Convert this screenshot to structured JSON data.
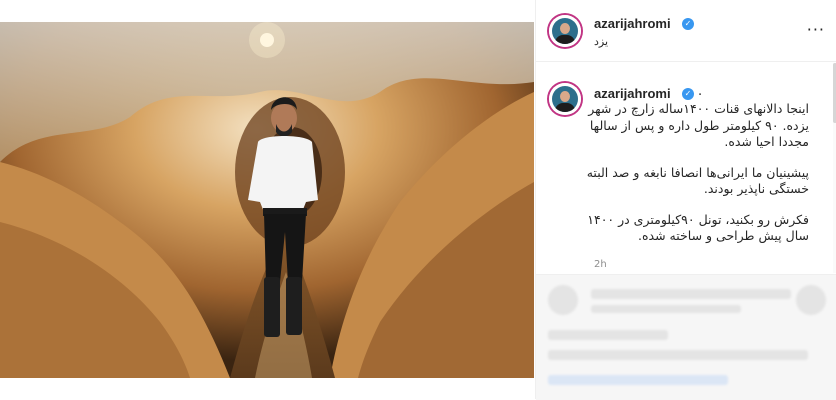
{
  "post": {
    "username": "azarijahromi",
    "location": "یزد",
    "more_label": "···",
    "caption": {
      "username": "azarijahromi",
      "dot": ".",
      "paragraphs": [
        "اینجا دالانهای قنات ۱۴۰۰ساله زارچ در شهر یزده. ۹۰ کیلومتر طول داره و پس از سالها مجددا احیا شده.",
        "پیشینیان ما ایرانی‌ها انصافا نابغه و صد البته خستگی ناپذیر بودند.",
        "فکرش رو بکنید، تونل ۹۰کیلومتری در ۱۴۰۰ سال پیش طراحی و ساخته شده."
      ],
      "time": "2h"
    }
  },
  "colors": {
    "verified": "#3897f0",
    "avatar_ring": "#c13584",
    "photo_tunnel": "#b07a3e"
  },
  "icons": {
    "verified": "verified-badge-icon",
    "more": "more-options-icon"
  }
}
